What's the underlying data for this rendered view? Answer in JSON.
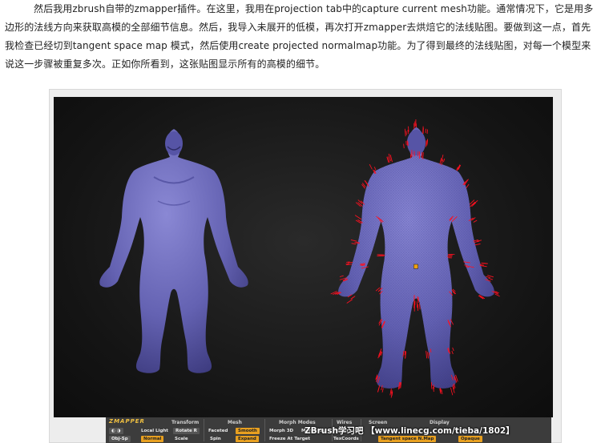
{
  "article": {
    "paragraph": "然后我用zbrush自带的zmapper插件。在这里，我用在projection tab中的capture current mesh功能。通常情况下，它是用多边形的法线方向来获取高模的全部细节信息。然后，我导入未展开的低模，再次打开zmapper去烘焙它的法线贴图。要做到这一点，首先我检查已经切到tangent space map 模式，然后使用create projected normalmap功能。为了得到最终的法线贴图，对每一个模型来说这一步骤被重复多次。正如你所看到，这张贴图显示所有的高模的细节。"
  },
  "zmapper": {
    "logo": "ZMAPPER",
    "headers": [
      "Transform",
      "Mesh",
      "Morph Modes",
      "Wires",
      "Screen",
      "Display"
    ],
    "row1": {
      "local_light": "Local Light",
      "rotate_r": "Rotate R",
      "faceted": "Faceted",
      "smooth": "Smooth",
      "morph3d": "Morph 3D",
      "morph_uv": "Morph UV",
      "polyframe": "PolyFra"
    },
    "row2": {
      "a": "Obj-Sp",
      "b": "Normal",
      "c": "Scale",
      "d": "Spin",
      "e": "Expand",
      "f": "Freeze At Target",
      "g": "TexCoords",
      "h": "Tangent space N.Map",
      "i": "Opaque"
    }
  },
  "watermark": "ZBrush学习吧 【www.linecg.com/tieba/1802】",
  "colors": {
    "model": "#6a68b8",
    "normals": "#ff1020",
    "accent": "#e8a020"
  }
}
